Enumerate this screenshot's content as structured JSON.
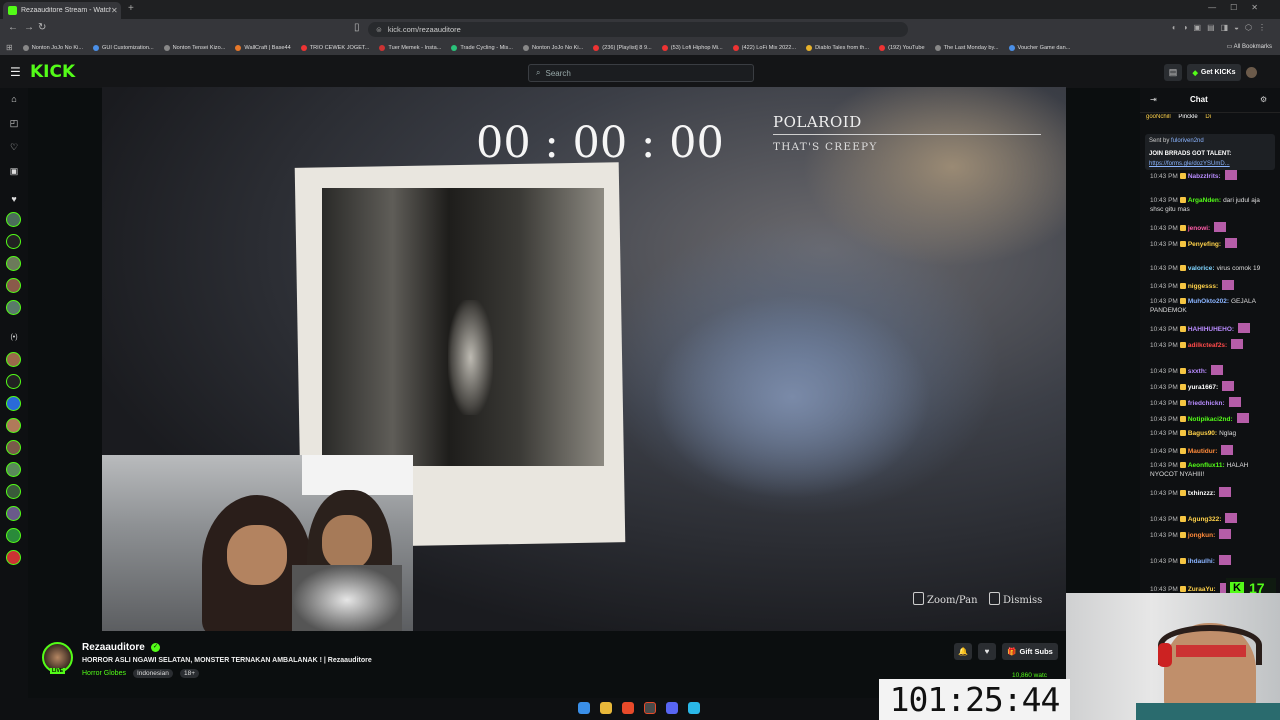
{
  "browser": {
    "tab_title": "Rezaauditore Stream - Watch",
    "url": "kick.com/rezaauditore",
    "bookmarks": [
      "Nonton JoJo No Ki...",
      "GUI Customization...",
      "Nonton Tensei Kizo...",
      "WallCraft | Base44",
      "TRIO CEWEK JOGET...",
      "Tuer Memek - Insta...",
      "Trade Cycling - Mis...",
      "Nonton JoJo No Ki...",
      "(236) [Playlist] 8 9...",
      "(53) Lofi Hiphop Mi...",
      "(422) LoFi Mix 2022...",
      "Diablo Tales from th...",
      "(192) YouTube",
      "The Last Monday by...",
      "Voucher Game dan..."
    ],
    "all_bookmarks": "All Bookmarks",
    "colors": {
      "bm": [
        "#888",
        "#4a8fe7",
        "#888",
        "#e7782a",
        "#e33",
        "#c33",
        "#2ac27a",
        "#888",
        "#e33",
        "#e33",
        "#e33",
        "#e7b12a",
        "#e33",
        "#888",
        "#4a8fe7"
      ]
    }
  },
  "header": {
    "logo": "KICK",
    "search_placeholder": "Search",
    "get_kicks": "Get KICKs"
  },
  "game": {
    "timer": "00 : 00 : 00",
    "polaroid_title": "POLAROID",
    "polaroid_subtitle": "THAT'S CREEPY",
    "zoom_pan": "Zoom/Pan",
    "dismiss": "Dismiss"
  },
  "channel": {
    "name": "Rezaauditore",
    "title": "HORROR ASLI NGAWI SELATAN, MONSTER TERNAKAN AMBALANAK ! | Rezaauditore",
    "category": "Horror Globes",
    "tags": [
      "Indonesian",
      "18+"
    ],
    "live": "LIVE",
    "gift_subs": "Gift Subs",
    "viewers": "10,860 watc"
  },
  "chat": {
    "title": "Chat",
    "pinned_users": [
      "gooNchill",
      "Pinckle",
      "Di"
    ],
    "pin_sent_by": "Sent by",
    "pin_sender": "fuloriven2nd",
    "pin_text": "JOIN BRRADS GOT TALENT:",
    "pin_link": "https://forms.gle/dozYSUmD...",
    "messages": [
      {
        "time": "10:43 PM",
        "user": "Nabzzlrits:",
        "text": "",
        "color": "#b98cff"
      },
      {
        "time": "10:43 PM",
        "user": "ArgaNden:",
        "text": "dari judul aja shsc gitu mas",
        "color": "#53fc18"
      },
      {
        "time": "10:43 PM",
        "user": "jenowi:",
        "text": "",
        "color": "#ff5ca8"
      },
      {
        "time": "10:43 PM",
        "user": "Penyefing:",
        "text": "",
        "color": "#ffd24a"
      },
      {
        "time": "10:43 PM",
        "user": "valorice:",
        "text": "virus comok 19",
        "color": "#7fd4ff"
      },
      {
        "time": "10:43 PM",
        "user": "niggesss:",
        "text": "",
        "color": "#ffd24a"
      },
      {
        "time": "10:43 PM",
        "user": "MuhOkto202:",
        "text": "GEJALA PANDEMOK",
        "color": "#8ab4ff"
      },
      {
        "time": "10:43 PM",
        "user": "HAHIHUHEHO:",
        "text": "",
        "color": "#b98cff"
      },
      {
        "time": "10:43 PM",
        "user": "adilkcteaf2s:",
        "text": "",
        "color": "#ff4a4a"
      },
      {
        "time": "10:43 PM",
        "user": "sxxth:",
        "text": "",
        "color": "#b98cff"
      },
      {
        "time": "10:43 PM",
        "user": "yura1667:",
        "text": "",
        "color": "#ffffff"
      },
      {
        "time": "10:43 PM",
        "user": "friedchickn:",
        "text": "",
        "color": "#b98cff"
      },
      {
        "time": "10:43 PM",
        "user": "Notipikaci2nd:",
        "text": "",
        "color": "#53fc18"
      },
      {
        "time": "10:43 PM",
        "user": "Bagus90:",
        "text": "Nglag",
        "color": "#ffd24a"
      },
      {
        "time": "10:43 PM",
        "user": "Mautidur:",
        "text": "",
        "color": "#ff8a3a"
      },
      {
        "time": "10:43 PM",
        "user": "Aeonflux11:",
        "text": "HALAH NYOCOT NYAHIII!",
        "color": "#53fc18"
      },
      {
        "time": "10:43 PM",
        "user": "txhinzzz:",
        "text": "",
        "color": "#ffffff"
      },
      {
        "time": "10:43 PM",
        "user": "Agung322:",
        "text": "",
        "color": "#ffd24a"
      },
      {
        "time": "10:43 PM",
        "user": "jongkun:",
        "text": "",
        "color": "#ff8a3a"
      },
      {
        "time": "10:43 PM",
        "user": "ihdaulhi:",
        "text": "",
        "color": "#8ab4ff"
      },
      {
        "time": "10:43 PM",
        "user": "ZuraaYu:",
        "text": "",
        "color": "#ffd24a"
      }
    ],
    "kick_count": "17"
  },
  "overlay": {
    "clock": "101:25:44"
  }
}
